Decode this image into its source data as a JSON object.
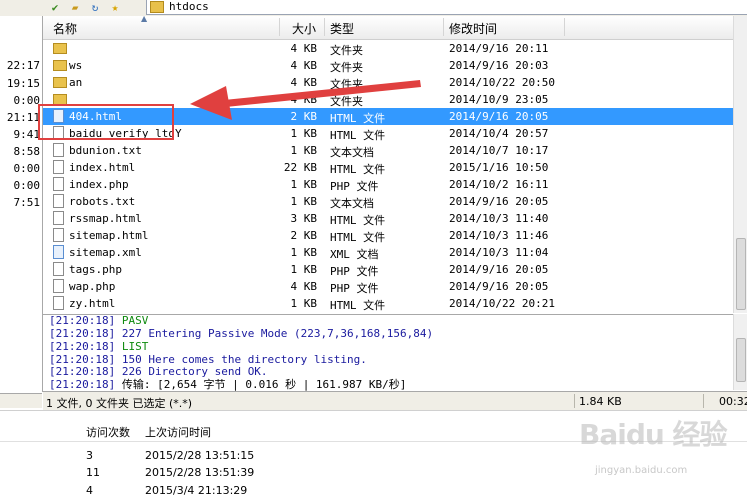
{
  "address": {
    "path": "htdocs"
  },
  "toolbar": {
    "icons": [
      "check-icon",
      "folder-open-icon",
      "refresh-icon",
      "star-icon"
    ]
  },
  "left_times": [
    "22:17",
    "19:15",
    "0:00",
    "21:11",
    "9:41",
    "8:58",
    "0:00",
    "0:00",
    "7:51"
  ],
  "list": {
    "headers": {
      "name": "名称",
      "size": "大小",
      "type": "类型",
      "modified": "修改时间"
    },
    "rows": [
      {
        "name": "",
        "size": "4 KB",
        "type": "文件夹",
        "modified": "2014/9/16 20:11",
        "icon": "folder"
      },
      {
        "name": "ws",
        "size": "4 KB",
        "type": "文件夹",
        "modified": "2014/9/16 20:03",
        "icon": "folder"
      },
      {
        "name": "an",
        "size": "4 KB",
        "type": "文件夹",
        "modified": "2014/10/22 20:50",
        "icon": "folder"
      },
      {
        "name": "",
        "size": "4 KB",
        "type": "文件夹",
        "modified": "2014/10/9 23:05",
        "icon": "folder"
      },
      {
        "name": "404.html",
        "size": "2 KB",
        "type": "HTML 文件",
        "modified": "2014/9/16 20:05",
        "icon": "file",
        "selected": true
      },
      {
        "name": "baidu_verify_ltdY",
        "size": "1 KB",
        "type": "HTML 文件",
        "modified": "2014/10/4 20:57",
        "icon": "file"
      },
      {
        "name": "bdunion.txt",
        "size": "1 KB",
        "type": "文本文档",
        "modified": "2014/10/7 10:17",
        "icon": "file"
      },
      {
        "name": "index.html",
        "size": "22 KB",
        "type": "HTML 文件",
        "modified": "2015/1/16 10:50",
        "icon": "file"
      },
      {
        "name": "index.php",
        "size": "1 KB",
        "type": "PHP 文件",
        "modified": "2014/10/2 16:11",
        "icon": "file"
      },
      {
        "name": "robots.txt",
        "size": "1 KB",
        "type": "文本文档",
        "modified": "2014/9/16 20:05",
        "icon": "file"
      },
      {
        "name": "rssmap.html",
        "size": "3 KB",
        "type": "HTML 文件",
        "modified": "2014/10/3 11:40",
        "icon": "file"
      },
      {
        "name": "sitemap.html",
        "size": "2 KB",
        "type": "HTML 文件",
        "modified": "2014/10/3 11:46",
        "icon": "file"
      },
      {
        "name": "sitemap.xml",
        "size": "1 KB",
        "type": "XML 文档",
        "modified": "2014/10/3 11:04",
        "icon": "xml"
      },
      {
        "name": "tags.php",
        "size": "1 KB",
        "type": "PHP 文件",
        "modified": "2014/9/16 20:05",
        "icon": "file"
      },
      {
        "name": "wap.php",
        "size": "4 KB",
        "type": "PHP 文件",
        "modified": "2014/9/16 20:05",
        "icon": "file"
      },
      {
        "name": "zy.html",
        "size": "1 KB",
        "type": "HTML 文件",
        "modified": "2014/10/22 20:21",
        "icon": "file"
      }
    ]
  },
  "log": [
    {
      "time": "[21:20:18]",
      "text": "PASV",
      "color": "green"
    },
    {
      "time": "[21:20:18]",
      "text": "227 Entering Passive Mode (223,7,36,168,156,84)",
      "color": "blue"
    },
    {
      "time": "[21:20:18]",
      "text": "LIST",
      "color": "green"
    },
    {
      "time": "[21:20:18]",
      "text": "150 Here comes the directory listing.",
      "color": "blue"
    },
    {
      "time": "[21:20:18]",
      "text": "226 Directory send OK.",
      "color": "blue"
    },
    {
      "time": "[21:20:18]",
      "text": "传输: [2,654 字节 | 0.016 秒 | 161.987 KB/秒]",
      "color": "black"
    }
  ],
  "status": {
    "selection": "1 文件, 0 文件夹  已选定 (*.*)",
    "size": "1.84 KB",
    "time": "00:32"
  },
  "bottom_table": {
    "headers": {
      "visits": "访问次数",
      "last_visit": "上次访问时间"
    },
    "rows": [
      {
        "visits": "3",
        "last_visit": "2015/2/28 13:51:15"
      },
      {
        "visits": "11",
        "last_visit": "2015/2/28 13:51:39"
      },
      {
        "visits": "4",
        "last_visit": "2015/3/4 21:13:29"
      }
    ]
  },
  "watermark": {
    "logo": "Baidu 经验",
    "sub": "jingyan.baidu.com"
  },
  "colors": {
    "selection": "#3399ff",
    "annotation": "#e0403f",
    "log_blue": "#1a1a9e",
    "log_green": "#0e8a0e"
  }
}
